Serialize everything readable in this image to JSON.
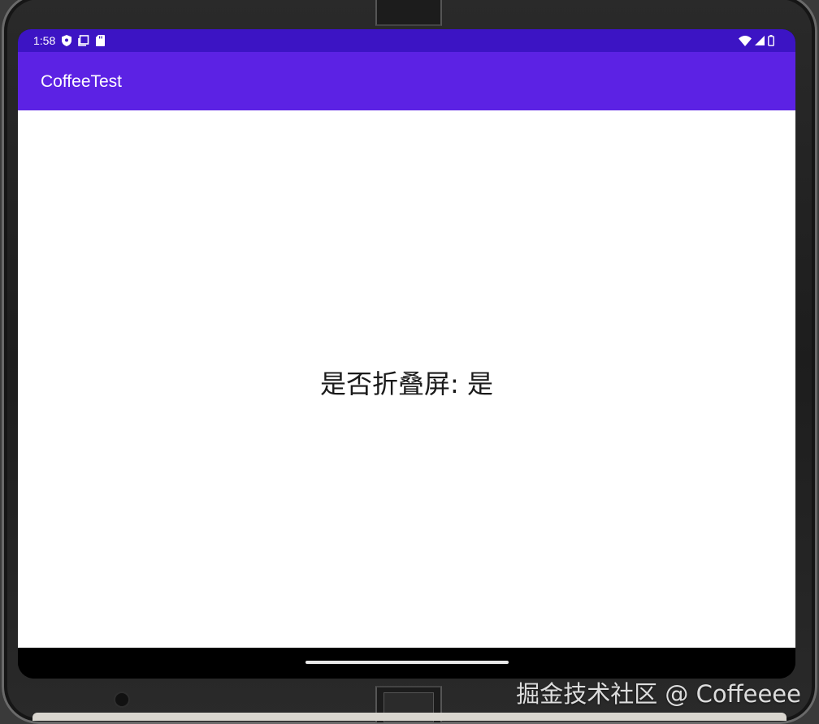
{
  "status_bar": {
    "time": "1:58",
    "left_icons": [
      "shield-icon",
      "screenshot-icon",
      "sd-card-icon"
    ],
    "right_icons": [
      "wifi-icon",
      "signal-icon",
      "battery-icon"
    ]
  },
  "app_bar": {
    "title": "CoffeeTest"
  },
  "main": {
    "message": "是否折叠屏: 是"
  },
  "watermark": {
    "text": "掘金技术社区 @ Coffeeee"
  },
  "colors": {
    "status_bar": "#3c14c4",
    "app_bar": "#5c22e4",
    "content_bg": "#ffffff"
  }
}
